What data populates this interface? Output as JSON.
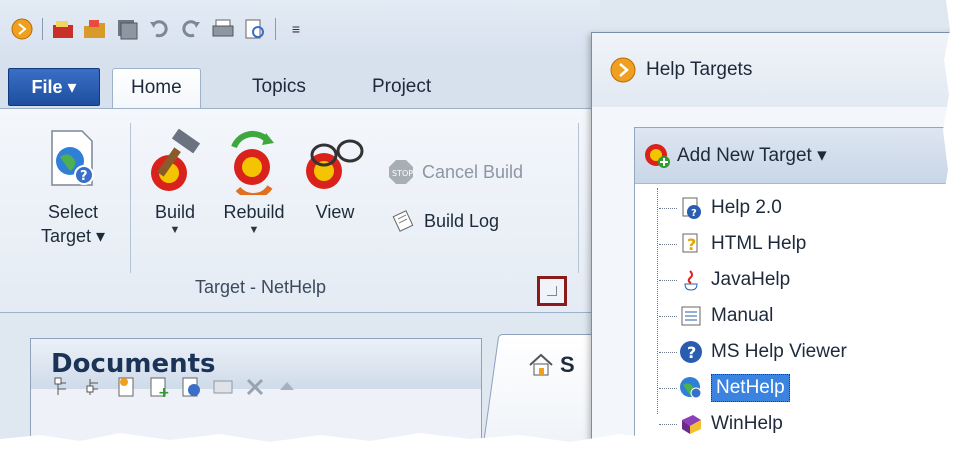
{
  "qat": {
    "icons": [
      "app-icon",
      "new-icon",
      "open-icon",
      "save-all-icon",
      "undo-icon",
      "redo-icon",
      "print-icon",
      "print-preview-icon"
    ],
    "customize_label": "≡"
  },
  "tabs": {
    "file_label": "File ▾",
    "items": [
      {
        "label": "Home",
        "active": true
      },
      {
        "label": "Topics",
        "active": false
      },
      {
        "label": "Project",
        "active": false
      }
    ]
  },
  "ribbon": {
    "select_target": {
      "line1": "Select",
      "line2": "Target ▾"
    },
    "build": {
      "label": "Build"
    },
    "rebuild": {
      "label": "Rebuild"
    },
    "view": {
      "label": "View"
    },
    "cancel_build": {
      "label": "Cancel Build"
    },
    "build_log": {
      "label": "Build Log"
    },
    "group_label": "Target - NetHelp"
  },
  "documents": {
    "title": "Documents"
  },
  "start_tab": {
    "label": "S"
  },
  "dialog": {
    "title": "Help Targets",
    "add_new_target": "Add New Target ▾",
    "targets": [
      {
        "label": "Help 2.0",
        "icon": "help2-icon",
        "selected": false
      },
      {
        "label": "HTML Help",
        "icon": "html-help-icon",
        "selected": false
      },
      {
        "label": "JavaHelp",
        "icon": "java-icon",
        "selected": false
      },
      {
        "label": "Manual",
        "icon": "manual-icon",
        "selected": false
      },
      {
        "label": "MS Help Viewer",
        "icon": "ms-help-viewer-icon",
        "selected": false
      },
      {
        "label": "NetHelp",
        "icon": "nethelp-icon",
        "selected": true
      },
      {
        "label": "WinHelp",
        "icon": "winhelp-icon",
        "selected": false
      }
    ]
  },
  "colors": {
    "accent": "#3b83e0",
    "file_button": "#2a5cb0",
    "launcher_highlight": "#8b1a1a"
  }
}
